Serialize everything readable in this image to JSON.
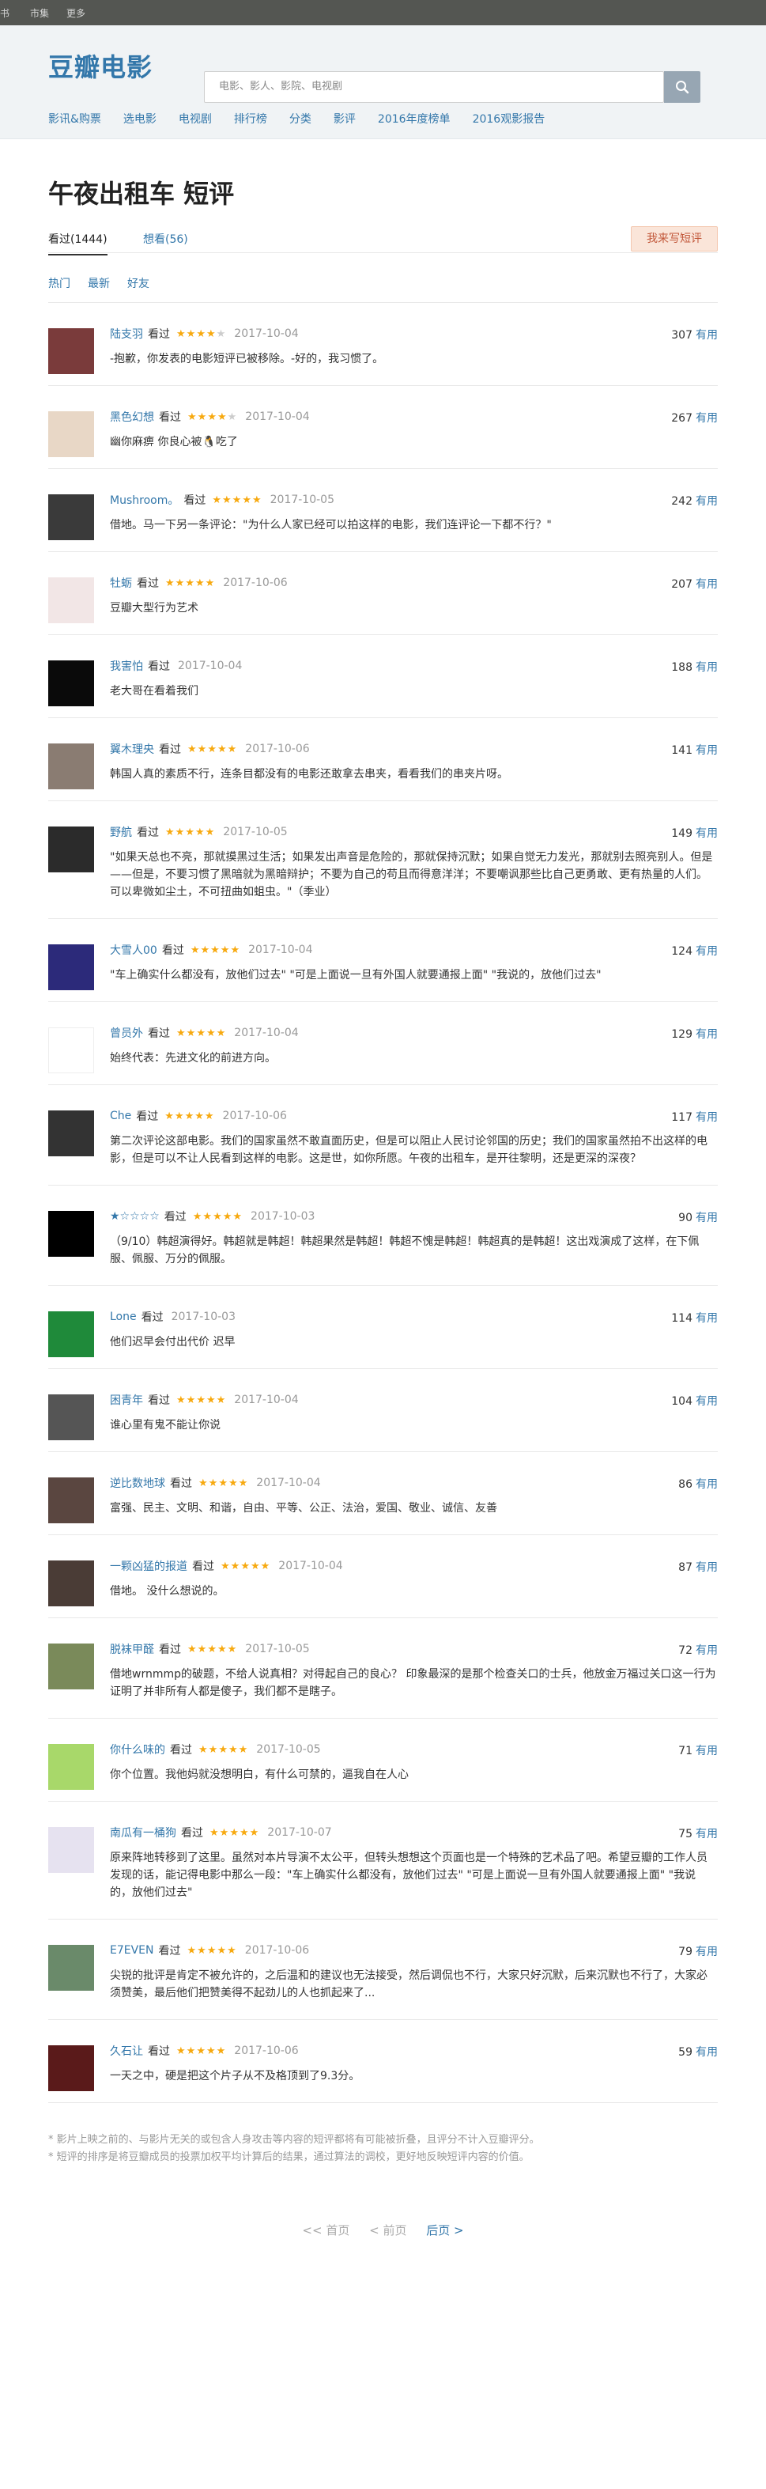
{
  "global_nav": {
    "items": [
      "书",
      "市集",
      "更多"
    ]
  },
  "header": {
    "logo": "豆瓣电影",
    "search_placeholder": "电影、影人、影院、电视剧",
    "search_icon": "search-icon",
    "nav": [
      "影讯&购票",
      "选电影",
      "电视剧",
      "排行榜",
      "分类",
      "影评",
      "2016年度榜单",
      "2016观影报告"
    ]
  },
  "page": {
    "title": "午夜出租车 短评",
    "tab_seen": "看过(1444)",
    "tab_want": "想看(56)",
    "write_button": "我来写短评",
    "sort": [
      "热门",
      "最新",
      "好友"
    ]
  },
  "comments": [
    {
      "user": "陆支羽",
      "status": "看过",
      "stars": 4,
      "time": "2017-10-04",
      "votes": "307",
      "useful": "有用",
      "text": "-抱歉，你发表的电影短评已被移除。-好的，我习惯了。",
      "avatar_color": "#7a3b3b"
    },
    {
      "user": "黑色幻想",
      "status": "看过",
      "stars": 4,
      "time": "2017-10-04",
      "votes": "267",
      "useful": "有用",
      "text": "幽你麻痹 你良心被🐧吃了",
      "avatar_color": "#e8d7c6"
    },
    {
      "user": "Mushroom。",
      "status": "看过",
      "stars": 5,
      "time": "2017-10-05",
      "votes": "242",
      "useful": "有用",
      "text": "借地。马一下另一条评论：\"为什么人家已经可以拍这样的电影，我们连评论一下都不行？\"",
      "avatar_color": "#3a3a3a"
    },
    {
      "user": "牡蛎",
      "status": "看过",
      "stars": 5,
      "time": "2017-10-06",
      "votes": "207",
      "useful": "有用",
      "text": "豆瓣大型行为艺术",
      "avatar_color": "#f2e6e6"
    },
    {
      "user": "我害怕",
      "status": "看过",
      "stars": 0,
      "time": "2017-10-04",
      "votes": "188",
      "useful": "有用",
      "text": "老大哥在看着我们",
      "avatar_color": "#0a0a0a"
    },
    {
      "user": "翼木理央",
      "status": "看过",
      "stars": 5,
      "time": "2017-10-06",
      "votes": "141",
      "useful": "有用",
      "text": "韩国人真的素质不行，连条目都没有的电影还敢拿去串夹，看看我们的串夹片呀。",
      "avatar_color": "#8a7c72"
    },
    {
      "user": "野航",
      "status": "看过",
      "stars": 5,
      "time": "2017-10-05",
      "votes": "149",
      "useful": "有用",
      "text": "\"如果天总也不亮，那就摸黑过生活；如果发出声音是危险的，那就保持沉默；如果自觉无力发光，那就别去照亮别人。但是——但是，不要习惯了黑暗就为黑暗辩护；不要为自己的苟且而得意洋洋；不要嘲讽那些比自己更勇敢、更有热量的人们。可以卑微如尘土，不可扭曲如蛆虫。\"（季业）",
      "avatar_color": "#2b2b2b"
    },
    {
      "user": "大雪人00",
      "status": "看过",
      "stars": 5,
      "time": "2017-10-04",
      "votes": "124",
      "useful": "有用",
      "text": "\"车上确实什么都没有，放他们过去\" \"可是上面说一旦有外国人就要通报上面\" \"我说的，放他们过去\"",
      "avatar_color": "#2c2a7a"
    },
    {
      "user": "曾员外",
      "status": "看过",
      "stars": 5,
      "time": "2017-10-04",
      "votes": "129",
      "useful": "有用",
      "text": "始终代表：先进文化的前进方向。",
      "avatar_color": "#ffffff"
    },
    {
      "user": "Che",
      "status": "看过",
      "stars": 5,
      "time": "2017-10-06",
      "votes": "117",
      "useful": "有用",
      "text": "第二次评论这部电影。我们的国家虽然不敢直面历史，但是可以阻止人民讨论邻国的历史；我们的国家虽然拍不出这样的电影，但是可以不让人民看到这样的电影。这是世，如你所愿。午夜的出租车，是开往黎明，还是更深的深夜？",
      "avatar_color": "#333333"
    },
    {
      "user": "★☆☆☆☆",
      "status": "看过",
      "stars": 5,
      "time": "2017-10-03",
      "votes": "90",
      "useful": "有用",
      "text": "（9/10）韩超演得好。韩超就是韩超！韩超果然是韩超！韩超不愧是韩超！韩超真的是韩超！这出戏演成了这样，在下佩服、佩服、万分的佩服。",
      "avatar_color": "#000000"
    },
    {
      "user": "Lone",
      "status": "看过",
      "stars": 0,
      "time": "2017-10-03",
      "votes": "114",
      "useful": "有用",
      "text": "他们迟早会付出代价 迟早",
      "avatar_color": "#1f8a3a"
    },
    {
      "user": "困青年",
      "status": "看过",
      "stars": 5,
      "time": "2017-10-04",
      "votes": "104",
      "useful": "有用",
      "text": "谁心里有鬼不能让你说",
      "avatar_color": "#555555"
    },
    {
      "user": "逆比数地球",
      "status": "看过",
      "stars": 5,
      "time": "2017-10-04",
      "votes": "86",
      "useful": "有用",
      "text": "富强、民主、文明、和谐，自由、平等、公正、法治，爱国、敬业、诚信、友善",
      "avatar_color": "#5a4640"
    },
    {
      "user": "一颗凶猛的报道",
      "status": "看过",
      "stars": 5,
      "time": "2017-10-04",
      "votes": "87",
      "useful": "有用",
      "text": "借地。 没什么想说的。",
      "avatar_color": "#4a3c36"
    },
    {
      "user": "脱袜甲醛",
      "status": "看过",
      "stars": 5,
      "time": "2017-10-05",
      "votes": "72",
      "useful": "有用",
      "text": "借地wrnmmp的破题，不给人说真相？对得起自己的良心？ 印象最深的是那个检查关口的士兵，他放金万福过关口这一行为证明了并非所有人都是傻子，我们都不是瞎子。",
      "avatar_color": "#7a8a5a"
    },
    {
      "user": "你什么味的",
      "status": "看过",
      "stars": 5,
      "time": "2017-10-05",
      "votes": "71",
      "useful": "有用",
      "text": "你个位置。我他妈就没想明白，有什么可禁的，逼我自在人心",
      "avatar_color": "#a8d86a"
    },
    {
      "user": "南瓜有一桶狗",
      "status": "看过",
      "stars": 5,
      "time": "2017-10-07",
      "votes": "75",
      "useful": "有用",
      "text": "原来阵地转移到了这里。虽然对本片导演不太公平，但转头想想这个页面也是一个特殊的艺术品了吧。希望豆瓣的工作人员发现的话，能记得电影中那么一段：\"车上确实什么都没有，放他们过去\" \"可是上面说一旦有外国人就要通报上面\" \"我说的，放他们过去\"",
      "avatar_color": "#e6e2f0"
    },
    {
      "user": "E7EVEN",
      "status": "看过",
      "stars": 5,
      "time": "2017-10-06",
      "votes": "79",
      "useful": "有用",
      "text": "尖锐的批评是肯定不被允许的，之后温和的建议也无法接受，然后调侃也不行，大家只好沉默，后来沉默也不行了，大家必须赞美，最后他们把赞美得不起劲儿的人也抓起来了...",
      "avatar_color": "#6a8a6a"
    },
    {
      "user": "久石让",
      "status": "看过",
      "stars": 5,
      "time": "2017-10-06",
      "votes": "59",
      "useful": "有用",
      "text": "一天之中，硬是把这个片子从不及格顶到了9.3分。",
      "avatar_color": "#5a1a1a"
    }
  ],
  "footnotes": [
    "* 影片上映之前的、与影片无关的或包含人身攻击等内容的短评都将有可能被折叠，且评分不计入豆瓣评分。",
    "* 短评的排序是将豆瓣成员的投票加权平均计算后的结果，通过算法的调校，更好地反映短评内容的价值。"
  ],
  "pager": {
    "first": "<< 首页",
    "prev": "< 前页",
    "next": "后页 >"
  }
}
